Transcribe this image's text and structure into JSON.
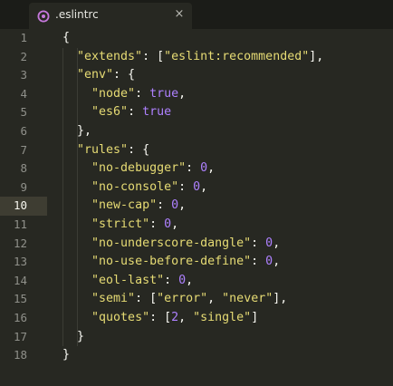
{
  "tab": {
    "title": ".eslintrc",
    "icon": "gear-icon",
    "close_glyph": "×"
  },
  "editor": {
    "active_line": 10,
    "lines": [
      {
        "num": "1",
        "indent": 0,
        "tokens": [
          {
            "t": "{",
            "c": "p"
          }
        ]
      },
      {
        "num": "2",
        "indent": 1,
        "tokens": [
          {
            "t": "\"extends\"",
            "c": "k"
          },
          {
            "t": ": [",
            "c": "p"
          },
          {
            "t": "\"eslint:recommended\"",
            "c": "k"
          },
          {
            "t": "],",
            "c": "p"
          }
        ]
      },
      {
        "num": "3",
        "indent": 1,
        "tokens": [
          {
            "t": "\"env\"",
            "c": "k"
          },
          {
            "t": ": {",
            "c": "p"
          }
        ]
      },
      {
        "num": "4",
        "indent": 2,
        "tokens": [
          {
            "t": "\"node\"",
            "c": "k"
          },
          {
            "t": ": ",
            "c": "p"
          },
          {
            "t": "true",
            "c": "n"
          },
          {
            "t": ",",
            "c": "p"
          }
        ]
      },
      {
        "num": "5",
        "indent": 2,
        "tokens": [
          {
            "t": "\"es6\"",
            "c": "k"
          },
          {
            "t": ": ",
            "c": "p"
          },
          {
            "t": "true",
            "c": "n"
          }
        ]
      },
      {
        "num": "6",
        "indent": 1,
        "tokens": [
          {
            "t": "},",
            "c": "p"
          }
        ]
      },
      {
        "num": "7",
        "indent": 1,
        "tokens": [
          {
            "t": "\"rules\"",
            "c": "k"
          },
          {
            "t": ": {",
            "c": "p"
          }
        ]
      },
      {
        "num": "8",
        "indent": 2,
        "tokens": [
          {
            "t": "\"no-debugger\"",
            "c": "k"
          },
          {
            "t": ": ",
            "c": "p"
          },
          {
            "t": "0",
            "c": "n"
          },
          {
            "t": ",",
            "c": "p"
          }
        ]
      },
      {
        "num": "9",
        "indent": 2,
        "tokens": [
          {
            "t": "\"no-console\"",
            "c": "k"
          },
          {
            "t": ": ",
            "c": "p"
          },
          {
            "t": "0",
            "c": "n"
          },
          {
            "t": ",",
            "c": "p"
          }
        ]
      },
      {
        "num": "10",
        "indent": 2,
        "tokens": [
          {
            "t": "\"new-cap\"",
            "c": "k"
          },
          {
            "t": ": ",
            "c": "p"
          },
          {
            "t": "0",
            "c": "n"
          },
          {
            "t": ",",
            "c": "p"
          }
        ]
      },
      {
        "num": "11",
        "indent": 2,
        "tokens": [
          {
            "t": "\"strict\"",
            "c": "k"
          },
          {
            "t": ": ",
            "c": "p"
          },
          {
            "t": "0",
            "c": "n"
          },
          {
            "t": ",",
            "c": "p"
          }
        ]
      },
      {
        "num": "12",
        "indent": 2,
        "tokens": [
          {
            "t": "\"no-underscore-dangle\"",
            "c": "k"
          },
          {
            "t": ": ",
            "c": "p"
          },
          {
            "t": "0",
            "c": "n"
          },
          {
            "t": ",",
            "c": "p"
          }
        ]
      },
      {
        "num": "13",
        "indent": 2,
        "tokens": [
          {
            "t": "\"no-use-before-define\"",
            "c": "k"
          },
          {
            "t": ": ",
            "c": "p"
          },
          {
            "t": "0",
            "c": "n"
          },
          {
            "t": ",",
            "c": "p"
          }
        ]
      },
      {
        "num": "14",
        "indent": 2,
        "tokens": [
          {
            "t": "\"eol-last\"",
            "c": "k"
          },
          {
            "t": ": ",
            "c": "p"
          },
          {
            "t": "0",
            "c": "n"
          },
          {
            "t": ",",
            "c": "p"
          }
        ]
      },
      {
        "num": "15",
        "indent": 2,
        "tokens": [
          {
            "t": "\"semi\"",
            "c": "k"
          },
          {
            "t": ": [",
            "c": "p"
          },
          {
            "t": "\"error\"",
            "c": "k"
          },
          {
            "t": ", ",
            "c": "p"
          },
          {
            "t": "\"never\"",
            "c": "k"
          },
          {
            "t": "],",
            "c": "p"
          }
        ]
      },
      {
        "num": "16",
        "indent": 2,
        "tokens": [
          {
            "t": "\"quotes\"",
            "c": "k"
          },
          {
            "t": ": [",
            "c": "p"
          },
          {
            "t": "2",
            "c": "n"
          },
          {
            "t": ", ",
            "c": "p"
          },
          {
            "t": "\"single\"",
            "c": "k"
          },
          {
            "t": "]",
            "c": "p"
          }
        ]
      },
      {
        "num": "17",
        "indent": 1,
        "tokens": [
          {
            "t": "}",
            "c": "p"
          }
        ]
      },
      {
        "num": "18",
        "indent": 0,
        "tokens": [
          {
            "t": "}",
            "c": "p"
          }
        ]
      }
    ]
  },
  "colors": {
    "background": "#272822",
    "string": "#e6db74",
    "number_boolean": "#ae81ff",
    "punctuation": "#f8f8f2",
    "line_number": "#8f908a"
  }
}
